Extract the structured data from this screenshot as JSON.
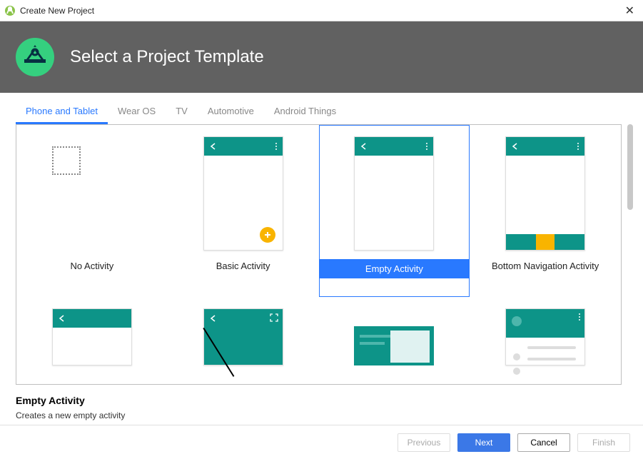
{
  "window": {
    "title": "Create New Project",
    "close_icon": "close-icon"
  },
  "banner": {
    "heading": "Select a Project Template"
  },
  "tabs": [
    {
      "label": "Phone and Tablet",
      "active": true
    },
    {
      "label": "Wear OS",
      "active": false
    },
    {
      "label": "TV",
      "active": false
    },
    {
      "label": "Automotive",
      "active": false
    },
    {
      "label": "Android Things",
      "active": false
    }
  ],
  "templates_row1": [
    {
      "label": "No Activity",
      "kind": "none",
      "selected": false
    },
    {
      "label": "Basic Activity",
      "kind": "basic",
      "selected": false
    },
    {
      "label": "Empty Activity",
      "kind": "empty",
      "selected": true
    },
    {
      "label": "Bottom Navigation Activity",
      "kind": "bottomnav",
      "selected": false
    }
  ],
  "templates_row2_visible": [
    {
      "kind": "back-only"
    },
    {
      "kind": "fullscreen"
    },
    {
      "kind": "master-detail"
    },
    {
      "kind": "nav-drawer"
    }
  ],
  "description": {
    "title": "Empty Activity",
    "body": "Creates a new empty activity"
  },
  "footer": {
    "previous": "Previous",
    "next": "Next",
    "cancel": "Cancel",
    "finish": "Finish"
  },
  "colors": {
    "accent": "#2979ff",
    "teal": "#0d9488",
    "amber": "#f9b400",
    "banner": "#616161"
  }
}
